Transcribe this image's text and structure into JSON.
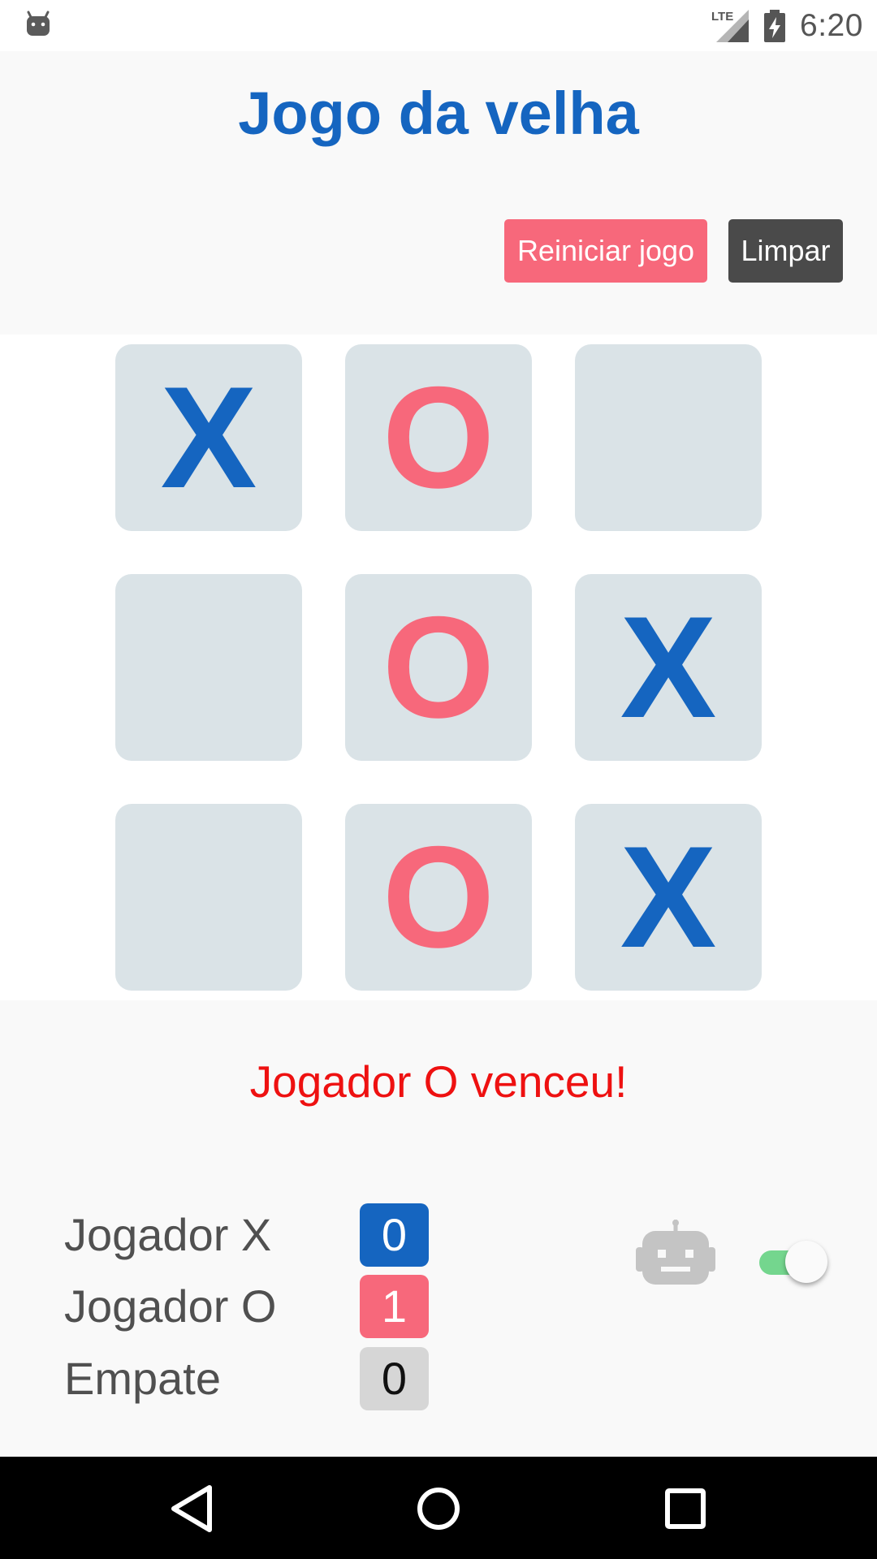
{
  "status_bar": {
    "time": "6:20",
    "network_label": "LTE",
    "icons": [
      "android-icon",
      "lte-signal-icon",
      "battery-charging-icon"
    ]
  },
  "header": {
    "title": "Jogo da velha",
    "restart_label": "Reiniciar jogo",
    "clear_label": "Limpar"
  },
  "board": {
    "cells": [
      [
        "X",
        "O",
        ""
      ],
      [
        "",
        "O",
        "X"
      ],
      [
        "",
        "O",
        "X"
      ]
    ]
  },
  "result": {
    "message": "Jogador O venceu!"
  },
  "scoreboard": {
    "rows": [
      {
        "label": "Jogador X",
        "value": "0"
      },
      {
        "label": "Jogador O",
        "value": "1"
      },
      {
        "label": "Empate",
        "value": "0"
      }
    ]
  },
  "ai_toggle": {
    "icon": "robot-icon",
    "enabled": true
  },
  "nav_bar": {
    "icons": [
      "back-icon",
      "home-icon",
      "recent-apps-icon"
    ]
  },
  "colors": {
    "title_blue": "#1565c0",
    "player_o_pink": "#f7687b",
    "clear_button": "#4a4a4a",
    "cell_bg": "#dae3e7",
    "result_red": "#ee1111",
    "switch_green": "#74d68e"
  }
}
